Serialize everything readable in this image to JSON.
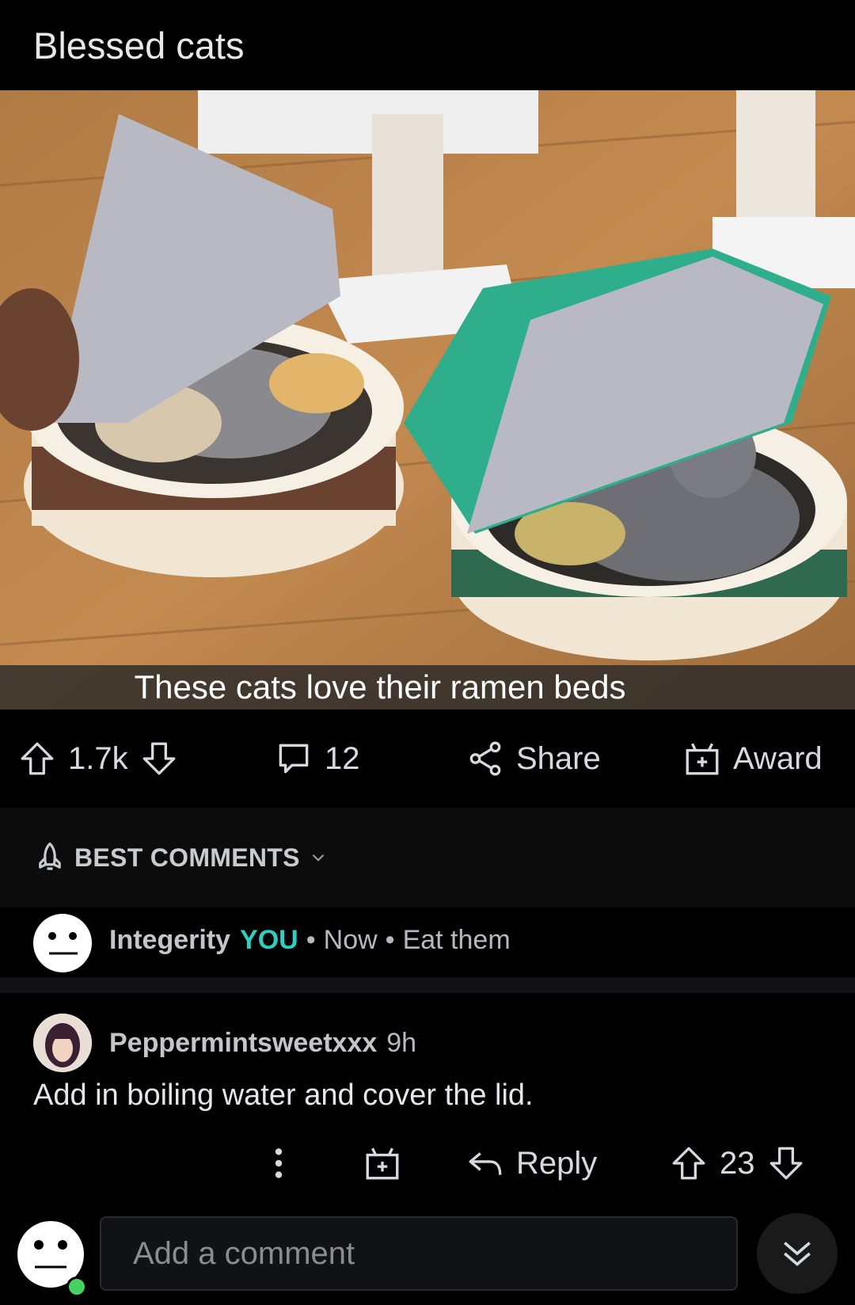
{
  "post": {
    "title": "Blessed cats",
    "image_caption": "These cats love their ramen beds"
  },
  "actions": {
    "upvote_count": "1.7k",
    "comment_count": "12",
    "share_label": "Share",
    "award_label": "Award"
  },
  "sort": {
    "label": "BEST COMMENTS"
  },
  "own_comment": {
    "username": "Integerity",
    "you_badge": "YOU",
    "time": "Now",
    "text": "Eat them"
  },
  "reply_comment": {
    "username": "Peppermintsweetxxx",
    "time": "9h",
    "text": "Add in boiling water and cover the lid.",
    "reply_label": "Reply",
    "vote_count": "23"
  },
  "composer": {
    "placeholder": "Add a comment"
  },
  "colors": {
    "background": "#000000",
    "you_badge": "#2ecec1",
    "online_indicator": "#46d160"
  },
  "icons": [
    "upvote-icon",
    "downvote-icon",
    "comment-bubble-icon",
    "share-icon",
    "award-gift-icon",
    "rocket-icon",
    "chevron-down-icon",
    "more-vertical-icon",
    "reply-arrow-icon",
    "double-chevron-down-icon"
  ]
}
